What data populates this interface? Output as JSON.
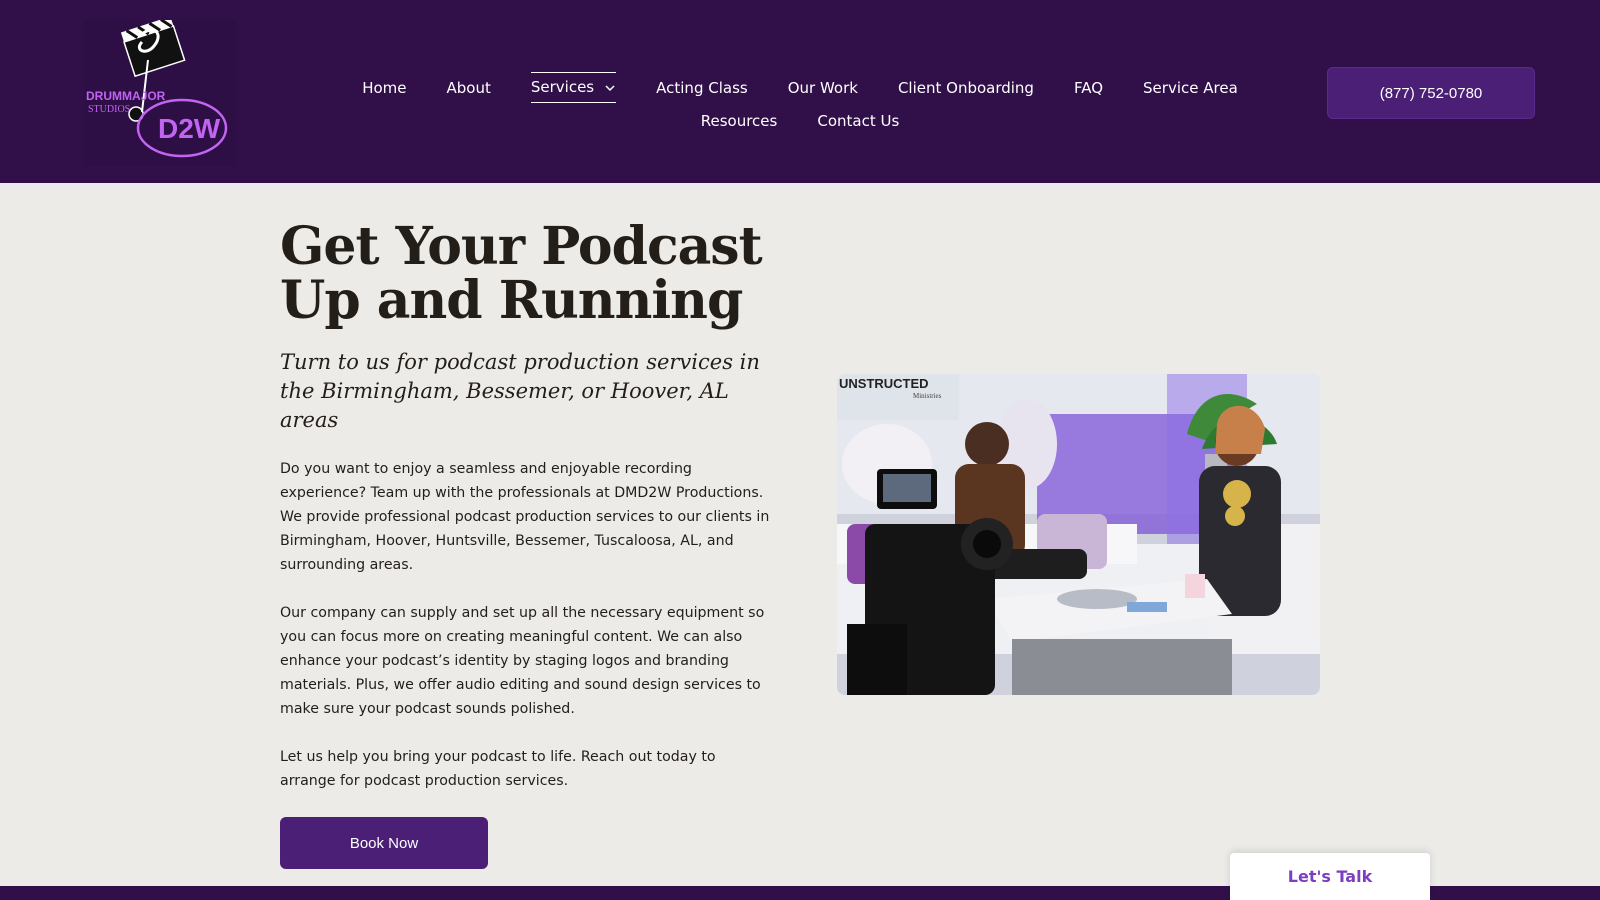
{
  "logo": {
    "brand_text": "DRUMMAJOR STUDIOS D2W",
    "alt": "DMD2W Productions logo"
  },
  "nav": {
    "row1": [
      "Home",
      "About",
      "Services",
      "Acting Class",
      "Our Work",
      "Client Onboarding",
      "FAQ",
      "Service Area"
    ],
    "row2": [
      "Resources",
      "Contact Us"
    ],
    "active": "Services"
  },
  "header": {
    "phone": "(877) 752-0780"
  },
  "hero": {
    "title_line1": "Get Your Podcast",
    "title_line2": "Up and Running",
    "subtitle": "Turn to us for podcast production services in the Birmingham, Bessemer, or Hoover, AL areas",
    "paragraphs": [
      "Do you want to enjoy a seamless and enjoyable recording experience? Team up with the professionals at DMD2W Productions. We provide professional podcast production services to our clients in Birmingham, Hoover, Huntsville, Bessemer, Tuscaloosa, AL, and surrounding areas.",
      "Our company can supply and set up all the necessary equipment so you can focus more on creating meaningful content. We can also enhance your podcast’s identity by staging logos and branding materials. Plus, we offer audio editing and sound design services to make sure your podcast sounds polished.",
      "Let us help you bring your podcast to life. Reach out today to arrange for podcast production services."
    ],
    "cta": "Book Now"
  },
  "photo": {
    "sign_text": "UNSTRUCTED",
    "sign_subtext": "Ministries"
  },
  "chat": {
    "label": "Let's Talk"
  },
  "colors": {
    "header_bg": "#31104a",
    "button_bg": "#4a1f75",
    "accent": "#7b3fc0",
    "page_bg": "#ecebe8"
  }
}
